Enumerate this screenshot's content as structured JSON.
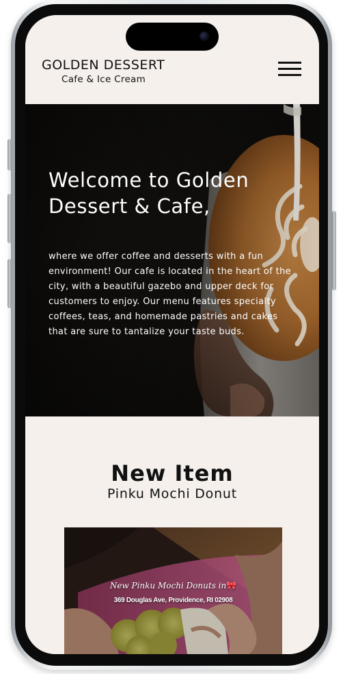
{
  "header": {
    "brand_title": "GOLDEN DESSERT",
    "brand_subtitle": "Cafe & Ice Cream",
    "menu_icon": "hamburger-menu-icon"
  },
  "hero": {
    "heading_line1": "Welcome to Golden",
    "heading_line2": "Dessert & Cafe,",
    "body": "where we offer coffee and desserts with a fun environment! Our cafe is located in the heart of the city, with a beautiful gazebo and upper deck for customers to enjoy. Our menu features specialty coffees, teas, and homemade pastries and cakes that are sure to tantalize your taste buds."
  },
  "new_item": {
    "title": "New Item",
    "subtitle": "Pinku Mochi Donut",
    "promo_caption": "New Pinku Mochi Donuts in",
    "promo_emoji": "🎀",
    "promo_address": "369 Douglas Ave, Providence, RI 02908"
  },
  "colors": {
    "page_background": "#f5f0eb",
    "text_dark": "#111111",
    "hero_text": "#ffffff"
  }
}
